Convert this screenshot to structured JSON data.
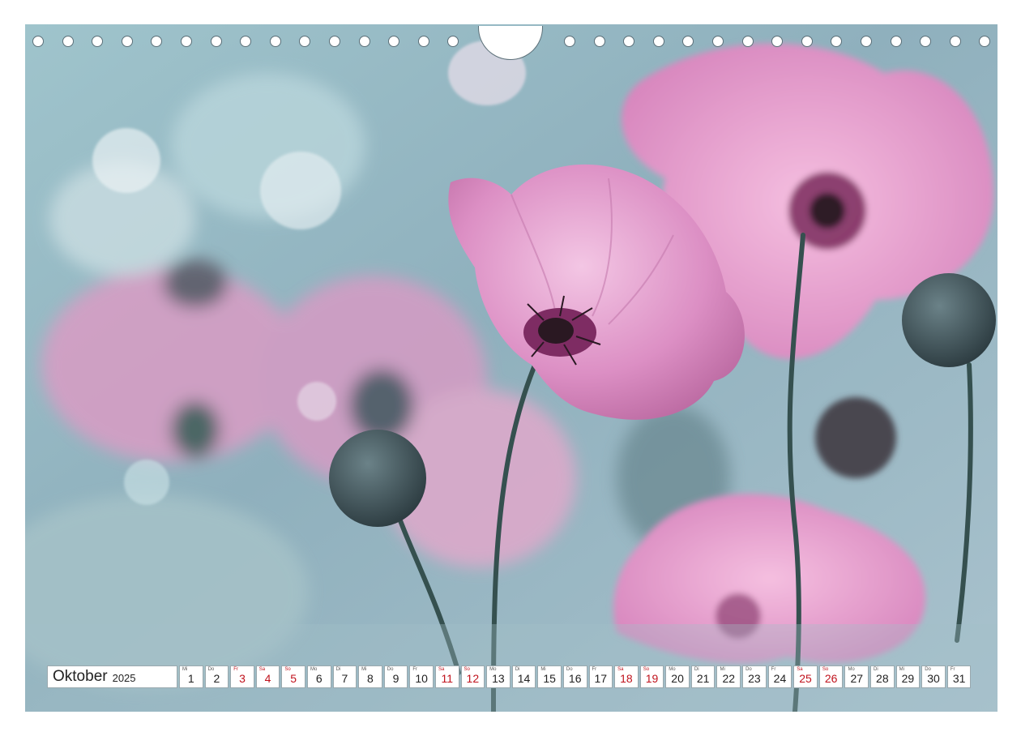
{
  "calendar": {
    "month": "Oktober",
    "year": "2025",
    "weekend_color": "#c0121c",
    "days": [
      {
        "wd": "Mi",
        "n": "1",
        "we": false
      },
      {
        "wd": "Do",
        "n": "2",
        "we": false
      },
      {
        "wd": "Fr",
        "n": "3",
        "we": true
      },
      {
        "wd": "Sa",
        "n": "4",
        "we": true
      },
      {
        "wd": "So",
        "n": "5",
        "we": true
      },
      {
        "wd": "Mo",
        "n": "6",
        "we": false
      },
      {
        "wd": "Di",
        "n": "7",
        "we": false
      },
      {
        "wd": "Mi",
        "n": "8",
        "we": false
      },
      {
        "wd": "Do",
        "n": "9",
        "we": false
      },
      {
        "wd": "Fr",
        "n": "10",
        "we": false
      },
      {
        "wd": "Sa",
        "n": "11",
        "we": true
      },
      {
        "wd": "So",
        "n": "12",
        "we": true
      },
      {
        "wd": "Mo",
        "n": "13",
        "we": false
      },
      {
        "wd": "Di",
        "n": "14",
        "we": false
      },
      {
        "wd": "Mi",
        "n": "15",
        "we": false
      },
      {
        "wd": "Do",
        "n": "16",
        "we": false
      },
      {
        "wd": "Fr",
        "n": "17",
        "we": false
      },
      {
        "wd": "Sa",
        "n": "18",
        "we": true
      },
      {
        "wd": "So",
        "n": "19",
        "we": true
      },
      {
        "wd": "Mo",
        "n": "20",
        "we": false
      },
      {
        "wd": "Di",
        "n": "21",
        "we": false
      },
      {
        "wd": "Mi",
        "n": "22",
        "we": false
      },
      {
        "wd": "Do",
        "n": "23",
        "we": false
      },
      {
        "wd": "Fr",
        "n": "24",
        "we": false
      },
      {
        "wd": "Sa",
        "n": "25",
        "we": true
      },
      {
        "wd": "So",
        "n": "26",
        "we": true
      },
      {
        "wd": "Mo",
        "n": "27",
        "we": false
      },
      {
        "wd": "Di",
        "n": "28",
        "we": false
      },
      {
        "wd": "Mi",
        "n": "29",
        "we": false
      },
      {
        "wd": "Do",
        "n": "30",
        "we": false
      },
      {
        "wd": "Fr",
        "n": "31",
        "we": false
      }
    ]
  },
  "photo": {
    "subject": "pink-poppy-flowers-with-buds",
    "palette": [
      "#8fb2bd",
      "#e9a8cf",
      "#3a4f55",
      "#c8dde3"
    ]
  }
}
